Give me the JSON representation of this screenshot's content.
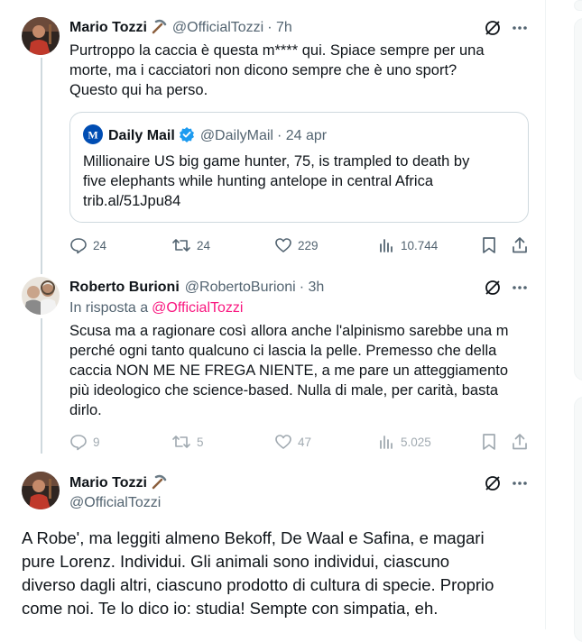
{
  "tweet1": {
    "name": "Mario Tozzi",
    "name_emoji": "⛏️",
    "handle": "@OfficialTozzi",
    "time": "· 7h",
    "text_lines": [
      "Purtroppo la caccia è questa m**** qui. Spiace sempre per una",
      "morte, ma i cacciatori non dicono sempre che è uno sport?",
      "Questo qui ha perso."
    ],
    "quote": {
      "name": "Daily Mail",
      "handle": "@DailyMail",
      "time": "· 24 apr",
      "text_lines": [
        "Millionaire US big game hunter, 75, is trampled to death by",
        "five elephants while hunting antelope in central Africa",
        "trib.al/51Jpu84"
      ]
    },
    "stats": {
      "replies": "24",
      "reposts": "24",
      "likes": "229",
      "views": "10.744"
    }
  },
  "tweet2": {
    "name": "Roberto Burioni",
    "handle": "@RobertoBurioni",
    "time": "· 3h",
    "reply_prefix": "In risposta a",
    "reply_to": "@OfficialTozzi",
    "text_lines": [
      "Scusa ma a ragionare così allora anche l'alpinismo sarebbe una m",
      "perché ogni tanto qualcuno ci lascia la pelle. Premesso che della",
      "caccia NON ME NE FREGA NIENTE, a me pare un atteggiamento",
      "più ideologico che science-based. Nulla di male, per carità, basta",
      "dirlo."
    ],
    "stats": {
      "replies": "9",
      "reposts": "5",
      "likes": "47",
      "views": "5.025"
    }
  },
  "tweet3": {
    "name": "Mario Tozzi",
    "name_emoji": "⛏️",
    "handle": "@OfficialTozzi",
    "text_lines": [
      "A Robe', ma leggiti almeno Bekoff, De Waal e Safina, e magari",
      "pure Lorenz. Individui. Gli animali sono individui,  ciascuno",
      "diverso dagli altri, ciascuno prodotto di cultura di specie. Proprio",
      "come noi. Te lo dico io: studia! Sempte con simpatia, eh."
    ]
  },
  "icons": [
    "grok-icon",
    "more-icon",
    "reply-icon",
    "repost-icon",
    "like-icon",
    "views-icon",
    "bookmark-icon",
    "share-icon",
    "verified-badge-icon"
  ],
  "colors": {
    "link": "#f91880",
    "verified": "#1d9bf0",
    "muted": "#536471"
  }
}
